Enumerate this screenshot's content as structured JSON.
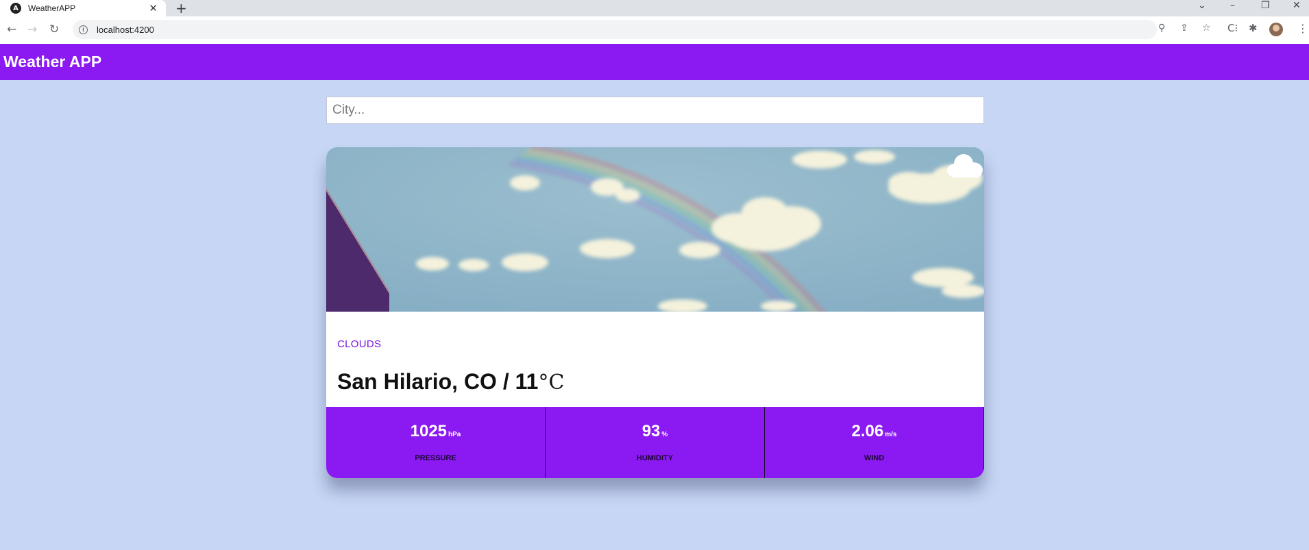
{
  "browser": {
    "tab_title": "WeatherAPP",
    "url": "localhost:4200"
  },
  "app": {
    "title": "Weather APP"
  },
  "search": {
    "placeholder": "City..."
  },
  "weather": {
    "condition": "CLOUDS",
    "city": "San Hilario, CO / 11",
    "temp_unit": "°C",
    "icon": "cloud-icon"
  },
  "stats": [
    {
      "value": "1025",
      "unit": "hPa",
      "label": "PRESSURE"
    },
    {
      "value": "93",
      "unit": "%",
      "label": "HUMIDITY"
    },
    {
      "value": "2.06",
      "unit": "m/s",
      "label": "WIND"
    }
  ],
  "colors": {
    "accent": "#8b19f1",
    "background": "#c6d6f4"
  }
}
